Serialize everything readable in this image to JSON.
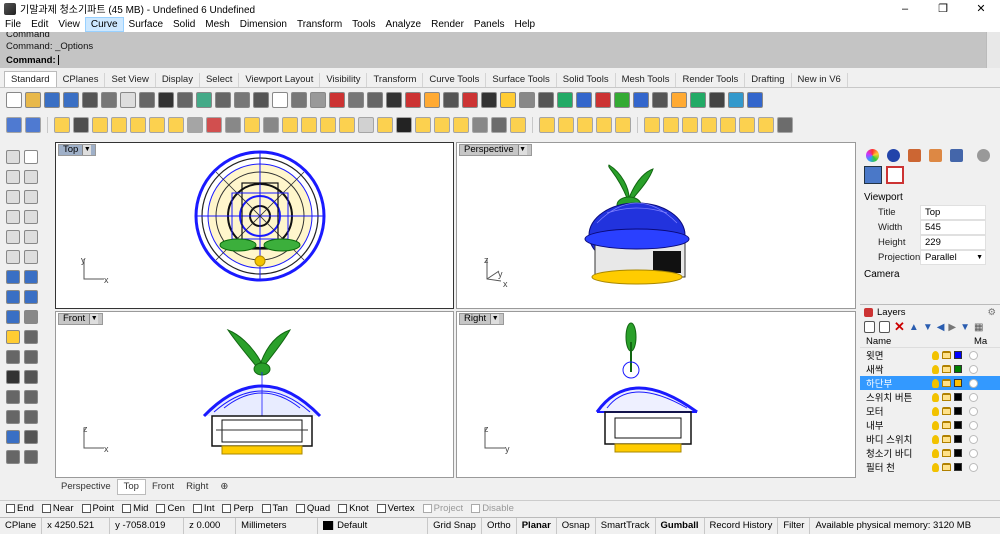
{
  "title": "기말과제 청소기파트 (45 MB) - Undefined 6 Undefined",
  "menu": [
    "File",
    "Edit",
    "View",
    "Curve",
    "Surface",
    "Solid",
    "Mesh",
    "Dimension",
    "Transform",
    "Tools",
    "Analyze",
    "Render",
    "Panels",
    "Help"
  ],
  "menu_active": "Curve",
  "command": {
    "history1": "Command",
    "history2": "Command: _Options",
    "prompt": "Command:"
  },
  "toolbar_tabs": [
    "Standard",
    "CPlanes",
    "Set View",
    "Display",
    "Select",
    "Viewport Layout",
    "Visibility",
    "Transform",
    "Curve Tools",
    "Surface Tools",
    "Solid Tools",
    "Mesh Tools",
    "Render Tools",
    "Drafting",
    "New in V6"
  ],
  "toolbar_selected": "Standard",
  "viewports": {
    "top": {
      "label": "Top",
      "ax_y": "y",
      "ax_x": "x"
    },
    "perspective": {
      "label": "Perspective",
      "ax_z": "z",
      "ax_y": "y",
      "ax_x": "x"
    },
    "front": {
      "label": "Front",
      "ax_z": "z",
      "ax_x": "x"
    },
    "right": {
      "label": "Right",
      "ax_z": "z",
      "ax_y": "y"
    }
  },
  "viewport_tabs": [
    "Perspective",
    "Top",
    "Front",
    "Right"
  ],
  "viewport_tab_selected": "Top",
  "properties": {
    "section": "Viewport",
    "rows": [
      {
        "key": "Title",
        "value": "Top"
      },
      {
        "key": "Width",
        "value": "545"
      },
      {
        "key": "Height",
        "value": "229"
      },
      {
        "key": "Projection",
        "value": "Parallel"
      }
    ],
    "camera": "Camera"
  },
  "layers": {
    "title": "Layers",
    "col_name": "Name",
    "col_mat": "Ma",
    "items": [
      {
        "name": "윗면",
        "color": "#0000ff",
        "selected": false
      },
      {
        "name": "새싹",
        "color": "#008000",
        "selected": false
      },
      {
        "name": "하단부",
        "color": "#ffc000",
        "selected": true
      },
      {
        "name": "스위치 버튼",
        "color": "#000000",
        "selected": false
      },
      {
        "name": "모터",
        "color": "#000000",
        "selected": false
      },
      {
        "name": "내부",
        "color": "#000000",
        "selected": false
      },
      {
        "name": "바디 스위치",
        "color": "#000000",
        "selected": false
      },
      {
        "name": "청소기 바디",
        "color": "#000000",
        "selected": false
      },
      {
        "name": "필터 천",
        "color": "#000000",
        "selected": false
      }
    ]
  },
  "osnap": [
    {
      "label": "End",
      "enabled": true
    },
    {
      "label": "Near",
      "enabled": true
    },
    {
      "label": "Point",
      "enabled": true
    },
    {
      "label": "Mid",
      "enabled": true
    },
    {
      "label": "Cen",
      "enabled": true
    },
    {
      "label": "Int",
      "enabled": true
    },
    {
      "label": "Perp",
      "enabled": true
    },
    {
      "label": "Tan",
      "enabled": true
    },
    {
      "label": "Quad",
      "enabled": true
    },
    {
      "label": "Knot",
      "enabled": true
    },
    {
      "label": "Vertex",
      "enabled": true
    },
    {
      "label": "Project",
      "enabled": false
    },
    {
      "label": "Disable",
      "enabled": false
    }
  ],
  "status": {
    "cplane": "CPlane",
    "x": "x 4250.521",
    "y": "y -7058.019",
    "z": "z 0.000",
    "units": "Millimeters",
    "layer": "Default",
    "grid_snap": "Grid Snap",
    "ortho": "Ortho",
    "planar": "Planar",
    "osnap": "Osnap",
    "smarttrack": "SmartTrack",
    "gumball": "Gumball",
    "record_history": "Record History",
    "filter": "Filter",
    "memory": "Available physical memory: 3120 MB"
  }
}
